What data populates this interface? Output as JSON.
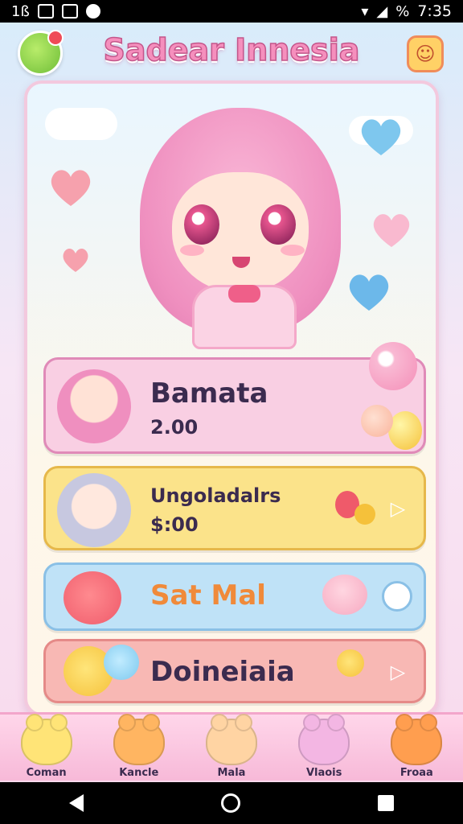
{
  "status_bar": {
    "left_text": "1ß",
    "time": "7:35",
    "battery_text": "%"
  },
  "header": {
    "title": "Sadear Innesia"
  },
  "items": [
    {
      "title": "Bamata",
      "value": "2.00",
      "color": "#f9cfe3",
      "border": "#e08ab8"
    },
    {
      "title": "Ungoladalrs",
      "value": "$:00",
      "color": "#fbe38a",
      "border": "#e6b84a"
    },
    {
      "title": "Sat Mal",
      "value": "",
      "color": "#bfe2f7",
      "border": "#8ac0e6"
    },
    {
      "title": "Doineiaia",
      "value": "",
      "color": "#f8b8b4",
      "border": "#e58a88"
    }
  ],
  "bottom_nav": [
    {
      "label": "Coman",
      "color": "#ffe477"
    },
    {
      "label": "Kancle",
      "color": "#ffb561"
    },
    {
      "label": "Mala",
      "color": "#ffd4a3"
    },
    {
      "label": "Vlaois",
      "color": "#f3b6e3"
    },
    {
      "label": "Froaa",
      "color": "#ff9e4f"
    }
  ]
}
